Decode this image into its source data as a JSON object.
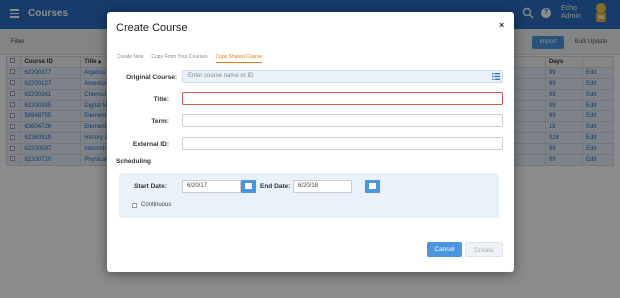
{
  "app": {
    "title": "Courses",
    "user_first": "Echo",
    "user_last": "Admin",
    "help_glyph": "?"
  },
  "filter": {
    "label": "Filter"
  },
  "toolbar": {
    "hidden_label": "...",
    "import_label": "Import",
    "bulk_label": "Bulk Update"
  },
  "grid": {
    "headers": [
      "",
      "Course ID",
      "Title ▴",
      "",
      "Days",
      ""
    ],
    "rows": [
      [
        "62200377",
        "Algebra",
        "99",
        "Edit"
      ],
      [
        "62200127",
        "America",
        "99",
        "Edit"
      ],
      [
        "62200361",
        "Chemist",
        "99",
        "Edit"
      ],
      [
        "62200385",
        "Digital M",
        "99",
        "Edit"
      ],
      [
        "58848755",
        "Element",
        "99",
        "Edit"
      ],
      [
        "63604726",
        "Element",
        "18",
        "Edit"
      ],
      [
        "62360919",
        "History c",
        "018",
        "Edit"
      ],
      [
        "62200597",
        "Internsh",
        "99",
        "Edit"
      ],
      [
        "62200720",
        "Physical",
        "99",
        "Edit"
      ]
    ]
  },
  "modal": {
    "title": "Create Course",
    "close_glyph": "×",
    "tabs": [
      {
        "label": "Create New",
        "active": false
      },
      {
        "label": "Copy From Your Courses",
        "active": false
      },
      {
        "label": "Copy Shared Course",
        "active": true
      }
    ],
    "fields": {
      "original_course": {
        "label": "Original Course:",
        "placeholder": "Enter course name or ID",
        "value": ""
      },
      "title": {
        "label": "Title:",
        "value": ""
      },
      "term": {
        "label": "Term:",
        "value": ""
      },
      "external_id": {
        "label": "External ID:",
        "value": ""
      }
    },
    "scheduling": {
      "heading": "Scheduling",
      "start_label": "Start Date:",
      "start_value": "6/20/17",
      "end_label": "End Date:",
      "end_value": "6/20/18",
      "continuous_label": "Continuous",
      "continuous_checked": false
    },
    "buttons": {
      "cancel": "Cancel",
      "create": "Create"
    }
  },
  "colors": {
    "brand": "#2a6cc4",
    "accent": "#4a95dd",
    "active_tab": "#e07b20",
    "error_border": "#d9534f"
  },
  "icons": [
    "menu-icon",
    "search-icon",
    "help-icon",
    "avatar",
    "close-icon",
    "list-icon",
    "calendar-icon"
  ]
}
